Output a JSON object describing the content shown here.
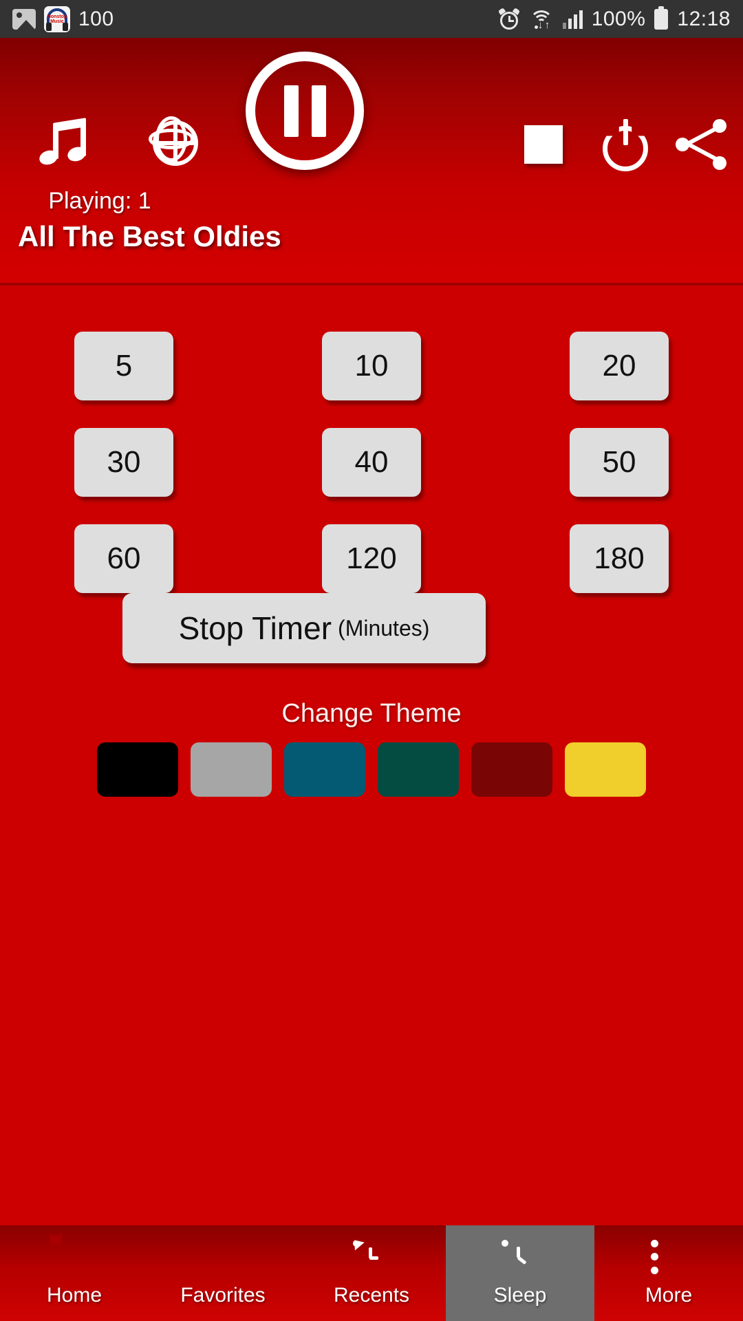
{
  "status_bar": {
    "battery_text": "100",
    "battery_percent": "100%",
    "time": "12:18",
    "icons": [
      "gallery-icon",
      "nonstop-music-app-icon",
      "alarm-icon",
      "wifi-icon",
      "signal-icon",
      "battery-icon"
    ],
    "app_icon_line1": "Nonstop",
    "app_icon_line2": "Music"
  },
  "header": {
    "music_icon": "music-note-icon",
    "globe_icon": "globe-icon",
    "playing_label": "Playing: 1",
    "pause_icon": "pause-icon",
    "stop_icon": "stop-icon",
    "power_icon": "power-icon",
    "share_icon": "share-icon",
    "station_title": "All The Best Oldies",
    "bg_top_color": "#800000",
    "bg_bottom_color": "#d40000"
  },
  "main": {
    "background_color": "#CC0000",
    "timer_buttons": [
      "5",
      "10",
      "20",
      "30",
      "40",
      "50",
      "60",
      "120",
      "180"
    ],
    "stop_timer_label": "Stop Timer",
    "stop_timer_unit": "(Minutes)",
    "change_theme_label": "Change Theme",
    "theme_swatches": [
      {
        "name": "black",
        "color": "#000000"
      },
      {
        "name": "gray",
        "color": "#A6A6A6"
      },
      {
        "name": "blue",
        "color": "#045A72"
      },
      {
        "name": "green",
        "color": "#044B42"
      },
      {
        "name": "maroon",
        "color": "#7A0505"
      },
      {
        "name": "yellow",
        "color": "#F0CE2B"
      }
    ]
  },
  "bottom_nav": {
    "items": [
      {
        "label": "Home",
        "icon": "radio-icon",
        "active": false
      },
      {
        "label": "Favorites",
        "icon": "star-icon",
        "active": false
      },
      {
        "label": "Recents",
        "icon": "history-icon",
        "active": false
      },
      {
        "label": "Sleep",
        "icon": "clock-icon",
        "active": true
      },
      {
        "label": "More",
        "icon": "more-vertical-icon",
        "active": false
      }
    ],
    "active_bg_color": "#6E6E6E"
  }
}
